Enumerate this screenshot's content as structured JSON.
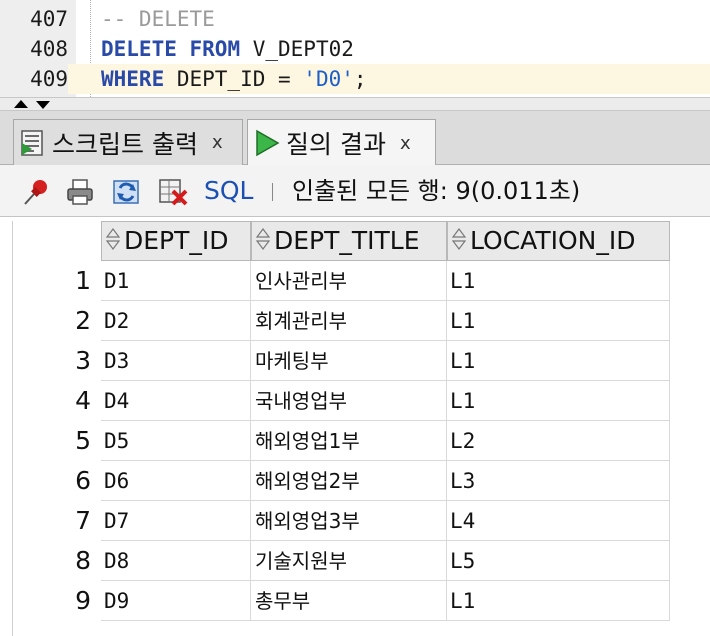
{
  "editor": {
    "lines": [
      {
        "num": "407",
        "text": "-- DELETE"
      },
      {
        "num": "408",
        "kw1": "DELETE",
        "kw2": "FROM",
        "rest": " V_DEPT02"
      },
      {
        "num": "409",
        "kw1": "WHERE",
        "rest": " DEPT_ID = ",
        "str": "'D0'",
        "end": ";"
      }
    ]
  },
  "tabs": [
    {
      "label": "스크립트 출력",
      "close": "x",
      "icon": "script-output-icon"
    },
    {
      "label": "질의 결과",
      "close": "x",
      "icon": "run-query-icon"
    }
  ],
  "toolbar": {
    "sql_label": "SQL",
    "status": "인출된 모든 행: 9(0.011초)"
  },
  "grid": {
    "columns": [
      "DEPT_ID",
      "DEPT_TITLE",
      "LOCATION_ID"
    ],
    "rows": [
      {
        "n": "1",
        "id": "D1",
        "title": "인사관리부",
        "loc": "L1"
      },
      {
        "n": "2",
        "id": "D2",
        "title": "회계관리부",
        "loc": "L1"
      },
      {
        "n": "3",
        "id": "D3",
        "title": "마케팅부",
        "loc": "L1"
      },
      {
        "n": "4",
        "id": "D4",
        "title": "국내영업부",
        "loc": "L1"
      },
      {
        "n": "5",
        "id": "D5",
        "title": "해외영업1부",
        "loc": "L2"
      },
      {
        "n": "6",
        "id": "D6",
        "title": "해외영업2부",
        "loc": "L3"
      },
      {
        "n": "7",
        "id": "D7",
        "title": "해외영업3부",
        "loc": "L4"
      },
      {
        "n": "8",
        "id": "D8",
        "title": "기술지원부",
        "loc": "L5"
      },
      {
        "n": "9",
        "id": "D9",
        "title": "총무부",
        "loc": "L1"
      }
    ]
  },
  "colors": {
    "keyword": "#2a4aa8",
    "comment": "#9a9a9a",
    "string": "#1d5ec7",
    "current_line": "#fdf7e2",
    "sql_link": "#1b4fb3"
  }
}
